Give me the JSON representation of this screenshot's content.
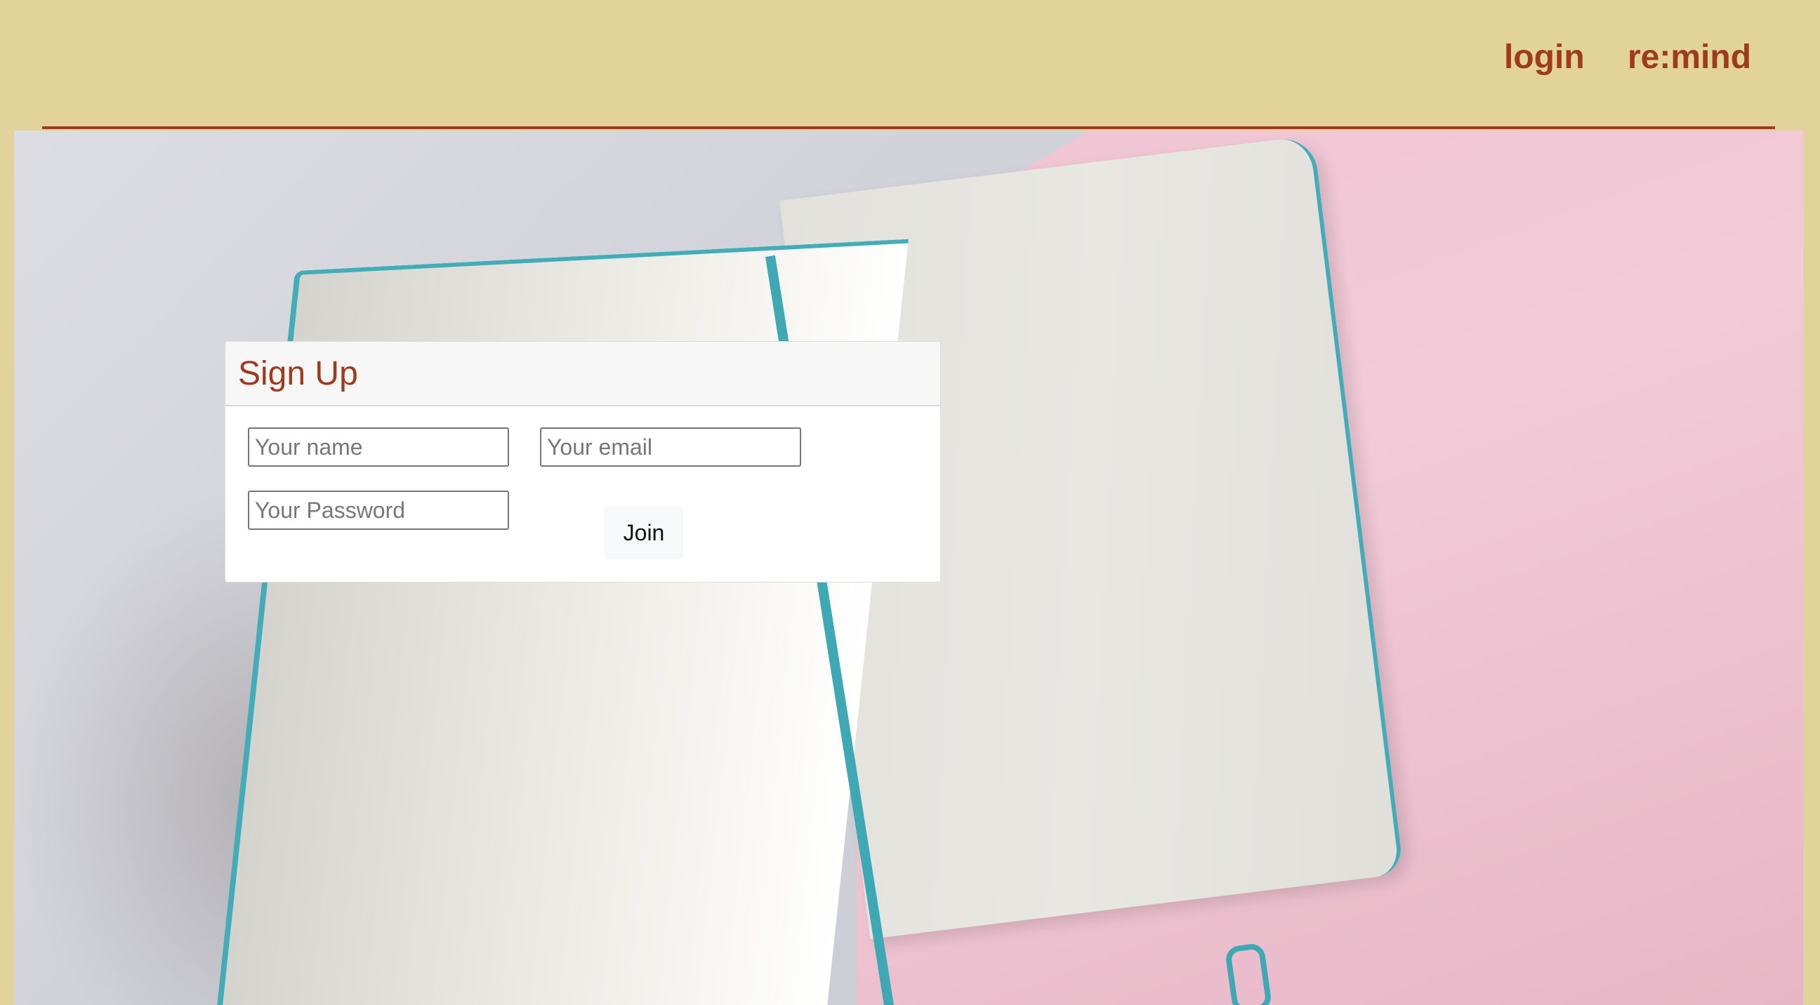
{
  "header": {
    "nav": {
      "login_label": "login",
      "brand_label": "re:mind"
    }
  },
  "signup": {
    "title": "Sign Up",
    "name_placeholder": "Your name",
    "email_placeholder": "Your email",
    "password_placeholder": "Your Password",
    "join_label": "Join"
  },
  "colors": {
    "page_background": "#e1d39a",
    "accent": "#9e3b1f",
    "ribbon": "#3ea9b5"
  }
}
